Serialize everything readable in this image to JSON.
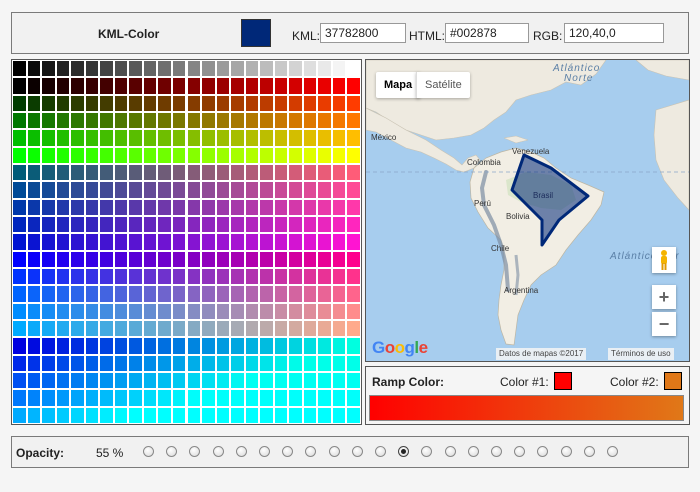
{
  "header": {
    "title": "KML-Color",
    "swatch_color": "#002878",
    "kml_label": "KML:",
    "kml_value": "37782800",
    "html_label": "HTML:",
    "html_value": "#002878",
    "rgb_label": "RGB:",
    "rgb_value": "120,40,0"
  },
  "map": {
    "tab_map": "Mapa",
    "tab_satellite": "Satélite",
    "labels": {
      "atlantico_norte_1": "Atlántico",
      "atlantico_norte_2": "Norte",
      "mexico": "México",
      "venezuela": "Venezuela",
      "colombia": "Colombia",
      "peru": "Perú",
      "brasil": "Brasil",
      "bolivia": "Bolivia",
      "chile": "Chile",
      "argentina": "Argentina",
      "atlantico_sur": "Atlántico Sur"
    },
    "zoom_in": "+",
    "zoom_out": "−",
    "logo": "Google",
    "attribution": "Datos de mapas ©2017",
    "terms": "Términos de uso",
    "polygon_color": "#002878"
  },
  "ramp": {
    "label": "Ramp Color:",
    "color1_label": "Color #1:",
    "color1": "#ff0000",
    "color2_label": "Color #2:",
    "color2": "#e07818"
  },
  "opacity": {
    "label": "Opacity:",
    "value": "55 %",
    "count": 21,
    "selected_index": 11
  }
}
